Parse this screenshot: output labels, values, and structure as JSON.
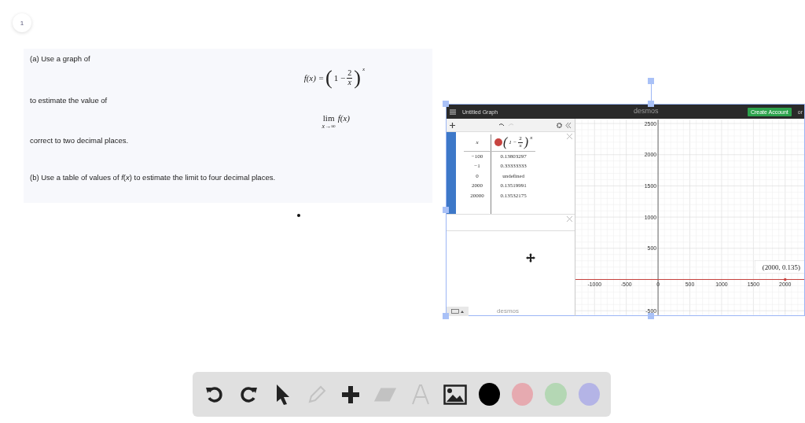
{
  "page_number": "1",
  "problem": {
    "part_a_intro": "(a) Use a graph of",
    "function": {
      "lhs": "f(x) =",
      "open": "(",
      "one": "1 −",
      "num": "2",
      "den": "x",
      "close": ")",
      "exp": "x"
    },
    "part_a_mid": "to estimate the value of",
    "limit": {
      "op": "lim",
      "sub": "x→∞",
      "arg": "f(x)"
    },
    "part_a_end": "correct to two decimal places.",
    "part_b": "(b) Use a table of values of *f*(*x*) to estimate the limit to four decimal places."
  },
  "desmos": {
    "title": "Untitled Graph",
    "logo": "desmos",
    "create_account": "Create Account",
    "or": "or",
    "table": {
      "x_header": "x",
      "expr": {
        "open": "(",
        "one": "1 −",
        "num": "2",
        "den": "x",
        "close": ")",
        "exp": "x"
      },
      "rows": [
        [
          "−100",
          "0.13803297"
        ],
        [
          "−1",
          "0.33333333"
        ],
        [
          "0",
          "undefined"
        ],
        [
          "2000",
          "0.13519991"
        ],
        [
          "20000",
          "0.13532175"
        ]
      ]
    },
    "footer_logo": "desmos",
    "chart_data": {
      "type": "line",
      "x": [
        -1300,
        2300
      ],
      "xlim": [
        -1300,
        2300
      ],
      "ylim": [
        -570,
        2560
      ],
      "grid": true,
      "xticks": [
        {
          "value": -1000,
          "label": "-1000"
        },
        {
          "value": -500,
          "label": "-500"
        },
        {
          "value": 0,
          "label": "0"
        },
        {
          "value": 500,
          "label": "500"
        },
        {
          "value": 1000,
          "label": "1000"
        },
        {
          "value": 1500,
          "label": "1500"
        },
        {
          "value": 2000,
          "label": "2000"
        }
      ],
      "yticks": [
        {
          "value": 2500,
          "label": "2500"
        },
        {
          "value": 2000,
          "label": "2000"
        },
        {
          "value": 1500,
          "label": "1500"
        },
        {
          "value": 1000,
          "label": "1000"
        },
        {
          "value": 500,
          "label": "500"
        },
        {
          "value": -500,
          "label": "-500"
        }
      ],
      "series": [
        {
          "color": "#c74440",
          "values": [
            0,
            0
          ]
        }
      ],
      "annotations": [
        {
          "x": 2000,
          "y": 0,
          "text": "(2000, 0.135)"
        }
      ]
    }
  },
  "toolbar": {
    "tools": [
      {
        "kind": "undo",
        "disabled": false
      },
      {
        "kind": "redo",
        "disabled": false
      },
      {
        "kind": "select",
        "disabled": false
      },
      {
        "kind": "pen",
        "disabled": true
      },
      {
        "kind": "plus",
        "disabled": false
      },
      {
        "kind": "eraser",
        "disabled": true
      },
      {
        "kind": "text",
        "disabled": true
      },
      {
        "kind": "image",
        "disabled": false
      }
    ],
    "colors": [
      {
        "color": "#000000"
      },
      {
        "color": "#e6aab0"
      },
      {
        "color": "#b4d7b4"
      },
      {
        "color": "#b4b4e6"
      }
    ]
  }
}
